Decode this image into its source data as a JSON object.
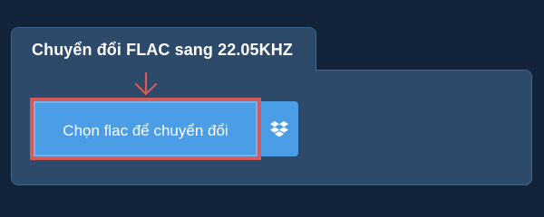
{
  "converter": {
    "tab_title": "Chuyển đổi FLAC sang 22.05KHZ",
    "convert_button_label": "Chọn flac để chuyển đổi",
    "dropbox_icon": "dropbox-icon",
    "arrow_icon": "arrow-down-icon"
  },
  "colors": {
    "page_background": "#12233a",
    "panel_background": "#2d4a6b",
    "button_blue": "#4b9de6",
    "highlight_red": "#d55a5a"
  }
}
